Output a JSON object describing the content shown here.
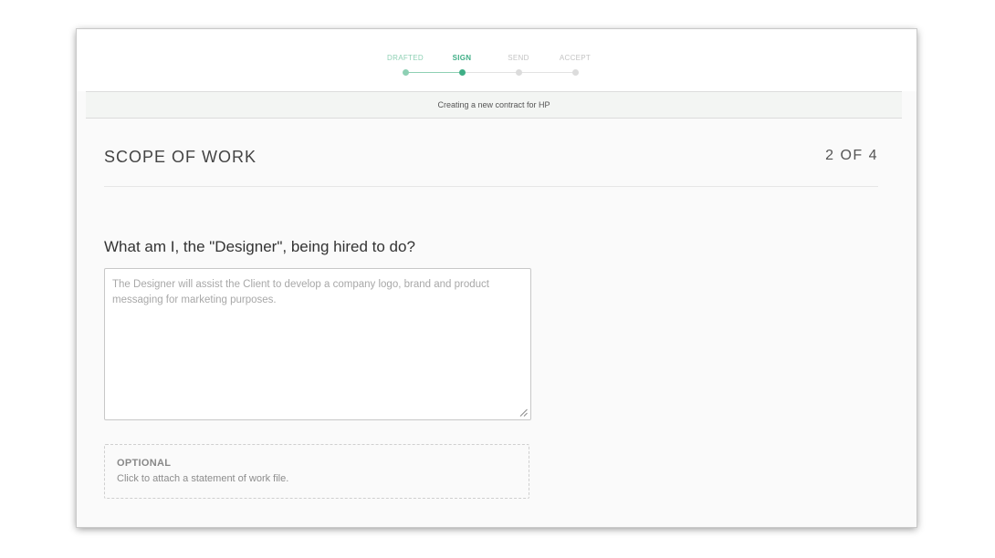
{
  "progress": {
    "steps": [
      {
        "label": "DRAFTED",
        "state": "done"
      },
      {
        "label": "SIGN",
        "state": "current"
      },
      {
        "label": "SEND",
        "state": "pending"
      },
      {
        "label": "ACCEPT",
        "state": "pending"
      }
    ]
  },
  "subheader": {
    "text": "Creating a new contract for HP"
  },
  "section": {
    "title": "SCOPE OF WORK",
    "counter": "2 OF 4"
  },
  "form": {
    "question": "What am I, the \"Designer\", being hired to do?",
    "scope_placeholder": "The Designer will assist the Client to develop a company logo, brand and product messaging for marketing purposes.",
    "scope_value": ""
  },
  "attachment": {
    "title": "OPTIONAL",
    "description": "Click to attach a statement of work file."
  },
  "colors": {
    "accent": "#3fae86",
    "accent_light": "#8ed0b4",
    "inactive": "#c4c4c4"
  }
}
